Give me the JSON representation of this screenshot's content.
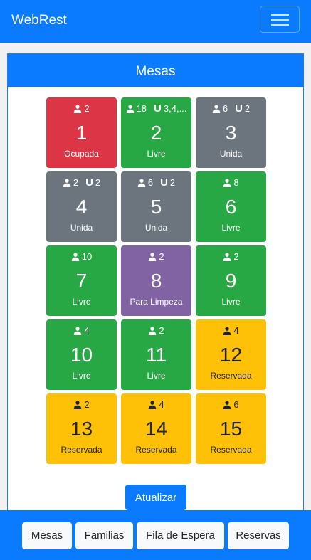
{
  "app": {
    "brand": "WebRest"
  },
  "card": {
    "title": "Mesas"
  },
  "tables": [
    {
      "number": "1",
      "status": "Ocupada",
      "capacity": "2",
      "join": "",
      "color": "red"
    },
    {
      "number": "2",
      "status": "Livre",
      "capacity": "18",
      "join": "3,4,...",
      "color": "green"
    },
    {
      "number": "3",
      "status": "Unida",
      "capacity": "6",
      "join": "2",
      "color": "gray"
    },
    {
      "number": "4",
      "status": "Unida",
      "capacity": "2",
      "join": "2",
      "color": "gray"
    },
    {
      "number": "5",
      "status": "Unida",
      "capacity": "6",
      "join": "2",
      "color": "gray"
    },
    {
      "number": "6",
      "status": "Livre",
      "capacity": "8",
      "join": "",
      "color": "green"
    },
    {
      "number": "7",
      "status": "Livre",
      "capacity": "10",
      "join": "",
      "color": "green"
    },
    {
      "number": "8",
      "status": "Para Limpeza",
      "capacity": "2",
      "join": "",
      "color": "purple"
    },
    {
      "number": "9",
      "status": "Livre",
      "capacity": "2",
      "join": "",
      "color": "green"
    },
    {
      "number": "10",
      "status": "Livre",
      "capacity": "4",
      "join": "",
      "color": "green"
    },
    {
      "number": "11",
      "status": "Livre",
      "capacity": "2",
      "join": "",
      "color": "green"
    },
    {
      "number": "12",
      "status": "Reservada",
      "capacity": "4",
      "join": "",
      "color": "yellow"
    },
    {
      "number": "13",
      "status": "Reservada",
      "capacity": "2",
      "join": "",
      "color": "yellow"
    },
    {
      "number": "14",
      "status": "Reservada",
      "capacity": "4",
      "join": "",
      "color": "yellow"
    },
    {
      "number": "15",
      "status": "Reservada",
      "capacity": "6",
      "join": "",
      "color": "yellow"
    }
  ],
  "actions": {
    "refresh_label": "Atualizar"
  },
  "bottom_nav": [
    {
      "label": "Mesas"
    },
    {
      "label": "Familias"
    },
    {
      "label": "Fila de Espera"
    },
    {
      "label": "Reservas"
    }
  ],
  "colors": {
    "primary": "#0a7bff",
    "occupied": "#dc3545",
    "free": "#28a745",
    "joined": "#6c757d",
    "cleaning": "#8163a3",
    "reserved": "#ffc107"
  },
  "icons": {
    "capacity": "person-icon",
    "joined_with": "union-icon",
    "menu": "hamburger-menu-icon"
  }
}
